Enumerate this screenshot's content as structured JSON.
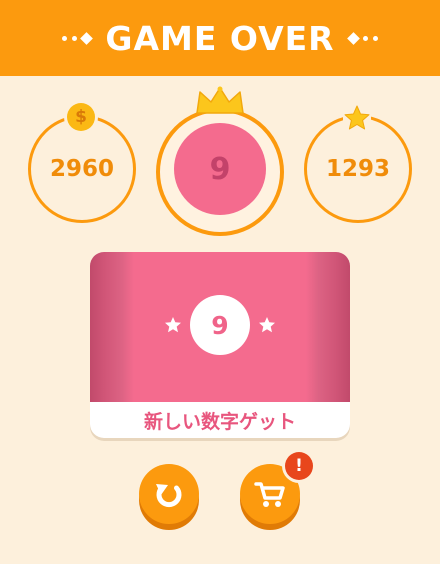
{
  "header": {
    "title": "GAME OVER"
  },
  "stats": {
    "coins": {
      "value": "2960",
      "icon": "coin-icon"
    },
    "best_number": {
      "value": "9",
      "icon": "crown-icon"
    },
    "stars": {
      "value": "1293",
      "icon": "star-icon"
    }
  },
  "reward_card": {
    "number": "9",
    "label": "新しい数字ゲット"
  },
  "buttons": {
    "replay": {
      "icon": "replay-icon"
    },
    "shop": {
      "icon": "cart-icon",
      "badge": "!"
    }
  },
  "colors": {
    "accent": "#fc9a0e",
    "background": "#fdf0dc",
    "pink": "#f46b8e",
    "alert": "#e8461c"
  }
}
